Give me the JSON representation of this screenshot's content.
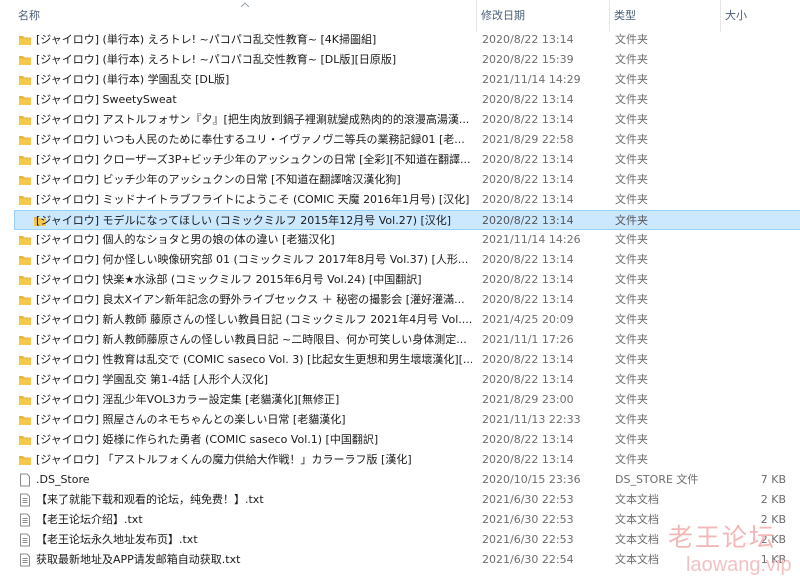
{
  "columns": {
    "name": "名称",
    "date": "修改日期",
    "type": "类型",
    "size": "大小"
  },
  "colors": {
    "folder": "#e8b53c",
    "selection": "#cce8ff",
    "header_text": "#4c607a"
  },
  "files": [
    {
      "name": "[ジャイロウ] (単行本) えろトレ! ~パコパコ乱交性教育~ [4K掃圖組]",
      "date": "2020/8/22 13:14",
      "type": "文件夹",
      "size": "",
      "icon": "folder-icon"
    },
    {
      "name": "[ジャイロウ] (単行本) えろトレ! ~パコパコ乱交性教育~ [DL版][日原版]",
      "date": "2020/8/22 15:39",
      "type": "文件夹",
      "size": "",
      "icon": "folder-icon"
    },
    {
      "name": "[ジャイロウ] (単行本) 学園乱交 [DL版]",
      "date": "2021/11/14 14:29",
      "type": "文件夹",
      "size": "",
      "icon": "folder-icon"
    },
    {
      "name": "[ジャイロウ] SweetySweat",
      "date": "2020/8/22 13:14",
      "type": "文件夹",
      "size": "",
      "icon": "folder-icon"
    },
    {
      "name": "[ジャイロウ] アストルフォサン『夕』[把生肉放到鍋子裡涮就變成熟肉的的滾漫高湯漢...",
      "date": "2020/8/22 13:14",
      "type": "文件夹",
      "size": "",
      "icon": "folder-icon"
    },
    {
      "name": "[ジャイロウ] いつも人民のために奉仕するユリ・イヴァノヴ二等兵の業務記録01 [老...",
      "date": "2021/8/29 22:58",
      "type": "文件夹",
      "size": "",
      "icon": "folder-icon"
    },
    {
      "name": "[ジャイロウ] クローザーズ3P+ビッチ少年のアッシュクンの日常 [全彩][不知道在翻譯...",
      "date": "2020/8/22 13:14",
      "type": "文件夹",
      "size": "",
      "icon": "folder-icon"
    },
    {
      "name": "[ジャイロウ] ビッチ少年のアッシュクンの日常 [不知道在翻譯啥汉漢化狗]",
      "date": "2020/8/22 13:14",
      "type": "文件夹",
      "size": "",
      "icon": "folder-icon"
    },
    {
      "name": "[ジャイロウ] ミッドナイトラブフライトにようこそ (COMIC 天魔 2016年1月号) [汉化]",
      "date": "2020/8/22 13:14",
      "type": "文件夹",
      "size": "",
      "icon": "folder-icon"
    },
    {
      "name": "[ジャイロウ] モデルになってほしい (コミックミルフ 2015年12月号 Vol.27) [汉化]",
      "date": "2020/8/22 13:14",
      "type": "文件夹",
      "size": "",
      "icon": "folder-icon",
      "selected": true
    },
    {
      "name": "[ジャイロウ] 個人的なショタと男の娘の体の違い [老猫汉化]",
      "date": "2021/11/14 14:26",
      "type": "文件夹",
      "size": "",
      "icon": "folder-icon"
    },
    {
      "name": "[ジャイロウ] 何か怪しい映像研究部 01 (コミックミルフ 2017年8月号 Vol.37) [人形...",
      "date": "2020/8/22 13:14",
      "type": "文件夹",
      "size": "",
      "icon": "folder-icon"
    },
    {
      "name": "[ジャイロウ] 快楽★水泳部 (コミックミルフ 2015年6月号 Vol.24) [中国翻訳]",
      "date": "2020/8/22 13:14",
      "type": "文件夹",
      "size": "",
      "icon": "folder-icon"
    },
    {
      "name": "[ジャイロウ] 良太Xイアン新年記念の野外ライブセックス ＋ 秘密の撮影会 [灌好灌滿...",
      "date": "2020/8/22 13:14",
      "type": "文件夹",
      "size": "",
      "icon": "folder-icon"
    },
    {
      "name": "[ジャイロウ] 新人教師 藤原さんの怪しい教員日記 (コミックミルフ 2021年4月号 Vol....",
      "date": "2021/4/25 20:09",
      "type": "文件夹",
      "size": "",
      "icon": "folder-icon"
    },
    {
      "name": "[ジャイロウ] 新人教師藤原さんの怪しい教員日記 ~二時限目、何か可笑しい身体測定...",
      "date": "2021/11/1 17:26",
      "type": "文件夹",
      "size": "",
      "icon": "folder-icon"
    },
    {
      "name": "[ジャイロウ] 性教育は乱交で (COMIC saseco Vol. 3) [比起女生更想和男生壞壞漢化][...",
      "date": "2020/8/22 13:14",
      "type": "文件夹",
      "size": "",
      "icon": "folder-icon"
    },
    {
      "name": "[ジャイロウ] 学園乱交 第1-4話 [人形个人汉化]",
      "date": "2020/8/22 13:14",
      "type": "文件夹",
      "size": "",
      "icon": "folder-icon"
    },
    {
      "name": "[ジャイロウ] 淫乱少年VOL3カラー設定集 [老貓漢化][無修正]",
      "date": "2021/8/29 23:00",
      "type": "文件夹",
      "size": "",
      "icon": "folder-icon"
    },
    {
      "name": "[ジャイロウ] 照屋さんのネモちゃんとの楽しい日常 [老貓漢化]",
      "date": "2021/11/13 22:33",
      "type": "文件夹",
      "size": "",
      "icon": "folder-icon"
    },
    {
      "name": "[ジャイロウ] 姫様に作られた勇者 (COMIC saseco Vol.1) [中国翻訳]",
      "date": "2020/8/22 13:14",
      "type": "文件夹",
      "size": "",
      "icon": "folder-icon"
    },
    {
      "name": "[ジャイロウ] 「アストルフォくんの魔力供給大作戦！」カラーラフ版 [漢化]",
      "date": "2020/8/22 13:14",
      "type": "文件夹",
      "size": "",
      "icon": "folder-icon"
    },
    {
      "name": ".DS_Store",
      "date": "2020/10/15 23:36",
      "type": "DS_STORE 文件",
      "size": "7 KB",
      "icon": "blank-file-icon"
    },
    {
      "name": "【来了就能下载和观看的论坛，纯免费！】.txt",
      "date": "2021/6/30 22:53",
      "type": "文本文档",
      "size": "2 KB",
      "icon": "text-file-icon"
    },
    {
      "name": "【老王论坛介绍】.txt",
      "date": "2021/6/30 22:53",
      "type": "文本文档",
      "size": "2 KB",
      "icon": "text-file-icon"
    },
    {
      "name": "【老王论坛永久地址发布页】.txt",
      "date": "2021/6/30 22:53",
      "type": "文本文档",
      "size": "2 KB",
      "icon": "text-file-icon"
    },
    {
      "name": "获取最新地址及APP请发邮箱自动获取.txt",
      "date": "2021/6/30 22:54",
      "type": "文本文档",
      "size": "1 KB",
      "icon": "text-file-icon"
    }
  ],
  "watermark": {
    "cn": "老王论坛",
    "en": "laowang.vip"
  }
}
